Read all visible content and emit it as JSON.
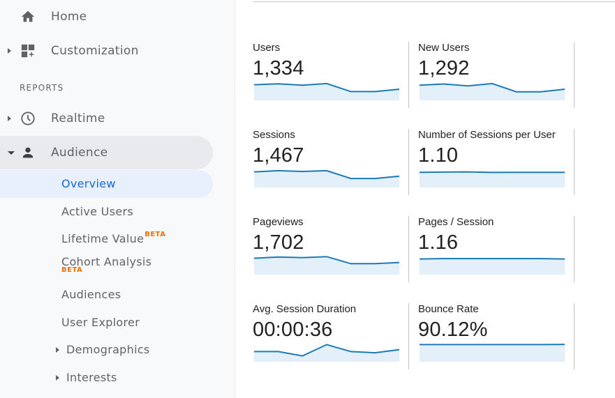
{
  "sidebar": {
    "home": "Home",
    "customization": "Customization",
    "reports_header": "REPORTS",
    "realtime": "Realtime",
    "audience": "Audience",
    "sub_items": {
      "overview": "Overview",
      "active_users": "Active Users",
      "lifetime_value": "Lifetime Value",
      "cohort_analysis": "Cohort Analysis",
      "audiences": "Audiences",
      "user_explorer": "User Explorer",
      "demographics": "Demographics",
      "interests": "Interests"
    },
    "beta_label": "BETA"
  },
  "colors": {
    "accent": "#1967d2",
    "beta": "#e8710a",
    "sparkline": "#1a7bb9",
    "sparkline_fill": "#e3f0f9"
  },
  "metrics": [
    {
      "title": "Users",
      "value": "1,334",
      "trend": [
        0.8,
        0.85,
        0.78,
        0.86,
        0.45,
        0.45,
        0.57
      ]
    },
    {
      "title": "New Users",
      "value": "1,292",
      "trend": [
        0.78,
        0.84,
        0.74,
        0.86,
        0.44,
        0.44,
        0.57
      ]
    },
    {
      "title": "Sessions",
      "value": "1,467",
      "trend": [
        0.8,
        0.86,
        0.82,
        0.86,
        0.46,
        0.46,
        0.58
      ]
    },
    {
      "title": "Number of Sessions per User",
      "value": "1.10",
      "trend": [
        0.78,
        0.79,
        0.8,
        0.77,
        0.78,
        0.78,
        0.78
      ]
    },
    {
      "title": "Pageviews",
      "value": "1,702",
      "trend": [
        0.84,
        0.9,
        0.87,
        0.92,
        0.56,
        0.56,
        0.62
      ]
    },
    {
      "title": "Pages / Session",
      "value": "1.16",
      "trend": [
        0.8,
        0.82,
        0.82,
        0.82,
        0.82,
        0.82,
        0.8
      ]
    },
    {
      "title": "Avg. Session Duration",
      "value": "00:00:36",
      "trend": [
        0.52,
        0.52,
        0.3,
        0.88,
        0.52,
        0.46,
        0.62
      ]
    },
    {
      "title": "Bounce Rate",
      "value": "90.12%",
      "trend": [
        0.88,
        0.88,
        0.88,
        0.88,
        0.88,
        0.88,
        0.89
      ]
    }
  ]
}
